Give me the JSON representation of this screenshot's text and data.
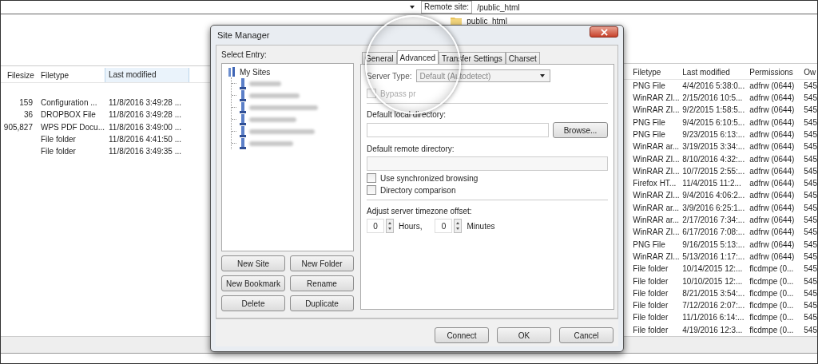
{
  "top_bar": {
    "remote_site_label": "Remote site:",
    "remote_path": "/public_html"
  },
  "remote_tree": {
    "items": [
      {
        "label": "public_html"
      }
    ]
  },
  "local_files": {
    "columns": [
      "Filesize",
      "Filetype",
      "Last modified"
    ],
    "rows": [
      [
        "159",
        "Configuration ...",
        "11/8/2016 3:49:28 ..."
      ],
      [
        "36",
        "DROPBOX File",
        "11/8/2016 3:49:28 ..."
      ],
      [
        "905,827",
        "WPS PDF Docu...",
        "11/8/2016 3:49:00 ..."
      ],
      [
        "",
        "File folder",
        "11/8/2016 4:41:50 ..."
      ],
      [
        "",
        "File folder",
        "11/8/2016 3:49:35 ..."
      ]
    ]
  },
  "remote_files": {
    "columns": [
      "Filetype",
      "Last modified",
      "Permissions",
      "Ow"
    ],
    "rows": [
      [
        "PNG File",
        "4/4/2016 5:38:0...",
        "adfrw (0644)",
        "545"
      ],
      [
        "WinRAR ZI...",
        "2/15/2016 10:5...",
        "adfrw (0644)",
        "545"
      ],
      [
        "WinRAR ZI...",
        "9/2/2015 1:58:5...",
        "adfrw (0644)",
        "545"
      ],
      [
        "PNG File",
        "9/4/2015 6:10:5...",
        "adfrw (0644)",
        "545"
      ],
      [
        "PNG File",
        "9/23/2015 6:13:...",
        "adfrw (0644)",
        "545"
      ],
      [
        "WinRAR ar...",
        "3/19/2015 3:34:...",
        "adfrw (0644)",
        "545"
      ],
      [
        "WinRAR ZI...",
        "8/10/2016 4:32:...",
        "adfrw (0644)",
        "545"
      ],
      [
        "WinRAR ZI...",
        "10/7/2015 2:55:...",
        "adfrw (0644)",
        "545"
      ],
      [
        "Firefox HT...",
        "11/4/2015 11:2...",
        "adfrw (0644)",
        "545"
      ],
      [
        "WinRAR ZI...",
        "9/4/2016 4:06:2...",
        "adfrw (0644)",
        "545"
      ],
      [
        "WinRAR ar...",
        "3/9/2016 6:25:1...",
        "adfrw (0644)",
        "545"
      ],
      [
        "WinRAR ar...",
        "2/17/2016 7:34:...",
        "adfrw (0644)",
        "545"
      ],
      [
        "WinRAR ZI...",
        "6/17/2016 7:08:...",
        "adfrw (0644)",
        "545"
      ],
      [
        "PNG File",
        "9/16/2015 5:13:...",
        "adfrw (0644)",
        "545"
      ],
      [
        "WinRAR ZI...",
        "5/13/2016 1:17:...",
        "adfrw (0644)",
        "545"
      ],
      [
        "File folder",
        "10/14/2015 12:...",
        "flcdmpe (0...",
        "545"
      ],
      [
        "File folder",
        "10/10/2015 12:...",
        "flcdmpe (0...",
        "545"
      ],
      [
        "File folder",
        "8/21/2015 3:54:...",
        "flcdmpe (0...",
        "545"
      ],
      [
        "File folder",
        "7/12/2016 2:07:...",
        "flcdmpe (0...",
        "545"
      ],
      [
        "File folder",
        "11/1/2016 6:14:...",
        "flcdmpe (0...",
        "545"
      ],
      [
        "File folder",
        "4/19/2016 12:3...",
        "flcdmpe (0...",
        "545"
      ]
    ]
  },
  "dialog": {
    "title": "Site Manager",
    "select_entry_label": "Select Entry:",
    "tree": {
      "label": "My Sites",
      "expanded": true,
      "children": [
        {
          "kind": "site"
        },
        {
          "kind": "site"
        },
        {
          "kind": "site"
        },
        {
          "kind": "site"
        },
        {
          "kind": "site"
        },
        {
          "kind": "site"
        }
      ]
    },
    "site_buttons": [
      "New Site",
      "New Folder",
      "New Bookmark",
      "Rename",
      "Delete",
      "Duplicate"
    ],
    "tabs": [
      {
        "label": "General",
        "selected": false
      },
      {
        "label": "Advanced",
        "selected": true
      },
      {
        "label": "Transfer Settings",
        "selected": false
      },
      {
        "label": "Charset",
        "selected": false
      }
    ],
    "server_type": {
      "label": "Server Type:",
      "value": "Default (Autodetect)",
      "disabled": true
    },
    "bypass_proxy": {
      "label": "Bypass pr",
      "checked": false,
      "disabled": true
    },
    "local_dir": {
      "label": "Default local directory:",
      "browse": "Browse..."
    },
    "remote_dir": {
      "label": "Default remote directory:"
    },
    "options": [
      {
        "label": "Use synchronized browsing",
        "checked": false
      },
      {
        "label": "Directory comparison",
        "checked": false
      }
    ],
    "timezone": {
      "label": "Adjust server timezone offset:",
      "hours": "0",
      "hours_label": "Hours,",
      "minutes": "0",
      "minutes_label": "Minutes"
    },
    "buttons": [
      "Connect",
      "OK",
      "Cancel"
    ]
  }
}
